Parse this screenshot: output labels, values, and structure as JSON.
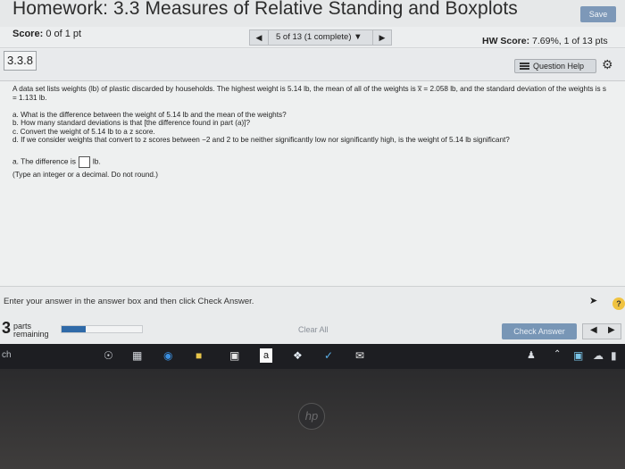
{
  "header": {
    "title": "Homework: 3.3 Measures of Relative Standing and Boxplots",
    "save_label": "Save"
  },
  "score_bar": {
    "score_label": "Score:",
    "score_value": "0 of 1 pt",
    "nav_select": "5 of 13 (1 complete) ▼",
    "hw_score_label": "HW Score:",
    "hw_score_value": "7.69%, 1 of 13 pts"
  },
  "question": {
    "number": "3.3.8",
    "help_label": "Question Help",
    "intro": "A data set lists weights (lb) of plastic discarded by households. The highest weight is 5.14 lb, the mean of all of the weights is x̅ = 2.058 lb, and the standard deviation of the weights is s = 1.131 lb.",
    "parts": [
      "a. What is the difference between the weight of 5.14 lb and the mean of the weights?",
      "b. How many standard deviations is that [the difference found in part (a)]?",
      "c. Convert the weight of 5.14 lb to a z score.",
      "d. If we consider weights that convert to z scores between −2 and 2 to be neither significantly low nor significantly high, is the weight of 5.14 lb significant?"
    ],
    "answer_prefix": "a. The difference is",
    "answer_unit": "lb.",
    "answer_value": "",
    "type_hint": "(Type an integer or a decimal. Do not round.)"
  },
  "footer": {
    "instruction": "Enter your answer in the answer box and then click Check Answer.",
    "parts_count": "3",
    "parts_label_1": "parts",
    "parts_label_2": "remaining",
    "progress_fraction": 0.3,
    "clear_all_label": "Clear All",
    "check_answer_label": "Check Answer",
    "help_symbol": "?"
  },
  "taskbar": {
    "search_fragment": "ch",
    "icons": [
      "mic-icon",
      "task-view-icon",
      "edge-icon",
      "file-explorer-icon",
      "store-icon",
      "amazon-icon",
      "dropbox-icon",
      "app-icon",
      "mail-icon"
    ],
    "amazon_letter": "a"
  },
  "colors": {
    "accent": "#2f6aa8",
    "save_button": "#7d98b8",
    "check_button": "#7896b6",
    "help_yellow": "#f0c341"
  }
}
